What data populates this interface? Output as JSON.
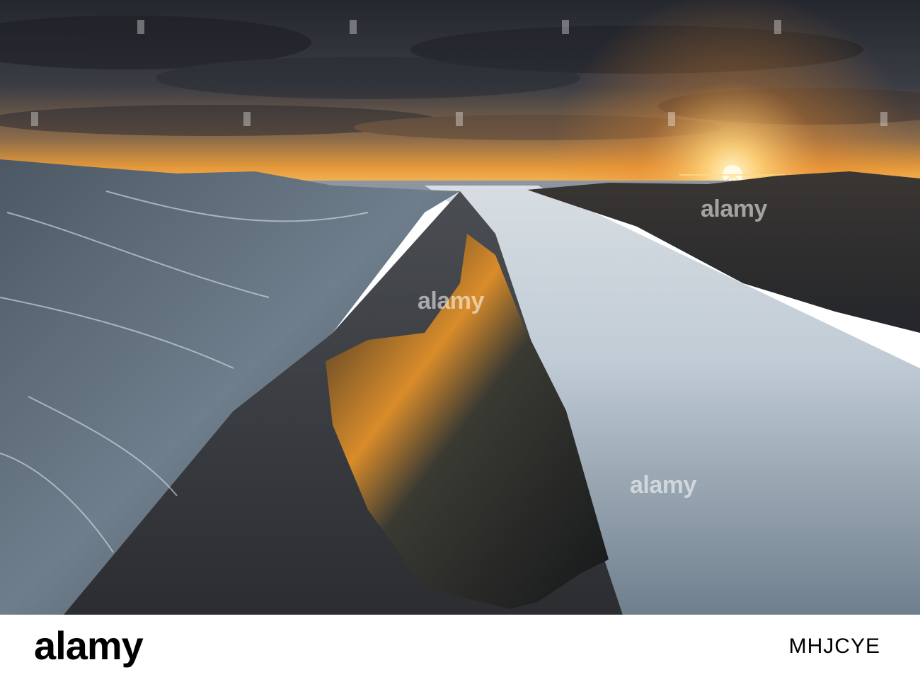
{
  "image": {
    "subject": "coastal rock formations at sunset",
    "palette": {
      "sky_dark": "#2b2e36",
      "sky_glow": "#f2a23a",
      "sun": "#fff3c0",
      "rock": "#5d6b78",
      "sand": "#2f3135",
      "water": "#b7c6d2"
    }
  },
  "watermark": {
    "text": "alamy"
  },
  "footer": {
    "logo_text": "alamy",
    "image_id": "MHJCYE"
  }
}
